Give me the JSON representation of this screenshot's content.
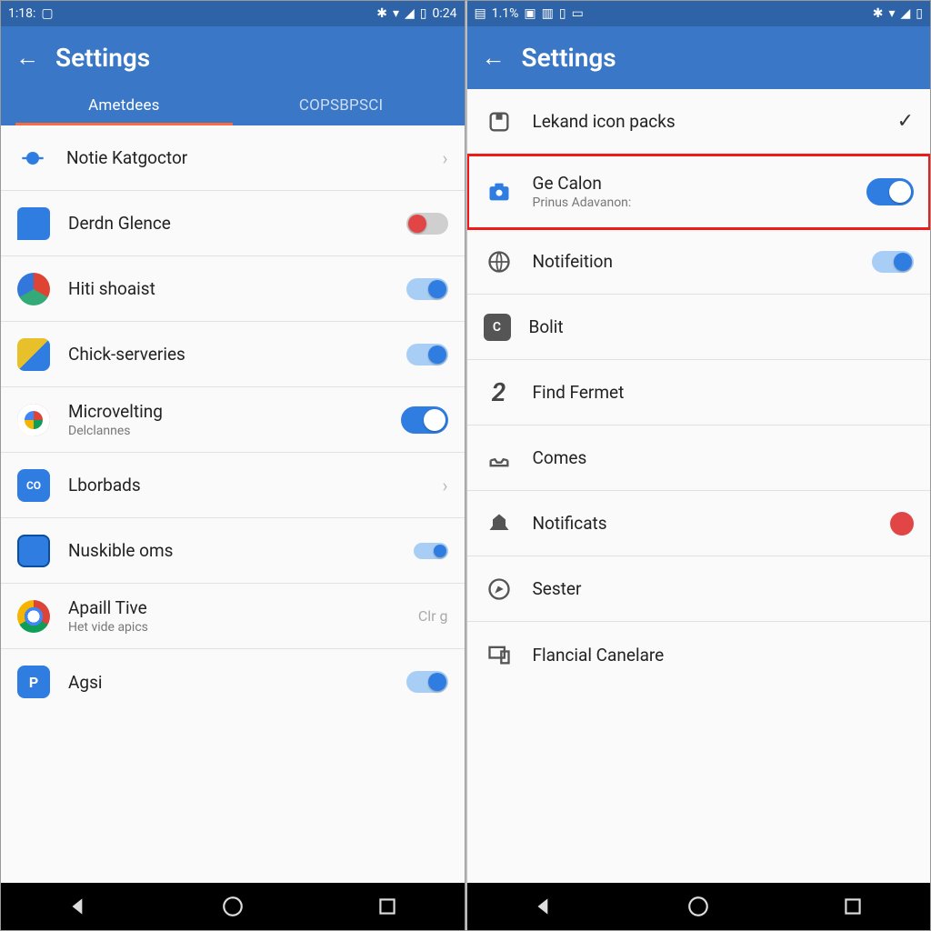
{
  "left": {
    "status": {
      "time": "1:18:",
      "clock": "0:24"
    },
    "title": "Settings",
    "tabs": [
      {
        "label": "Ametdees",
        "active": true
      },
      {
        "label": "COPSBPSCI",
        "active": false
      }
    ],
    "items": [
      {
        "label": "Notie Katgoctor",
        "sub": "",
        "end": "chev"
      },
      {
        "label": "Derdn Glence",
        "sub": "",
        "end": "pill-off"
      },
      {
        "label": "Hiti shoaist",
        "sub": "",
        "end": "pill-on"
      },
      {
        "label": "Chick-serveries",
        "sub": "",
        "end": "pill-on"
      },
      {
        "label": "Microvelting",
        "sub": "Delclannes",
        "end": "pill-onwhite"
      },
      {
        "label": "Lborbads",
        "sub": "",
        "end": "chev"
      },
      {
        "label": "Nuskible oms",
        "sub": "",
        "end": "pill-on-small"
      },
      {
        "label": "Apaill Tive",
        "sub": "Het vide apics",
        "end": "text",
        "endText": "Clr g"
      },
      {
        "label": "Agsi",
        "sub": "",
        "end": "pill-on"
      }
    ]
  },
  "right": {
    "status": {
      "left": "1.1%"
    },
    "title": "Settings",
    "items": [
      {
        "label": "Lekand icon packs",
        "sub": "",
        "end": "check"
      },
      {
        "label": "Ge Calon",
        "sub": "Prinus Adavanon:",
        "end": "pill-onwhite",
        "highlight": true
      },
      {
        "label": "Notifeition",
        "sub": "",
        "end": "pill-on"
      },
      {
        "label": "Bolit",
        "sub": "",
        "end": ""
      },
      {
        "label": "Find Fermet",
        "sub": "",
        "end": ""
      },
      {
        "label": "Comes",
        "sub": "",
        "end": ""
      },
      {
        "label": "Notificats",
        "sub": "",
        "end": "dot"
      },
      {
        "label": "Sester",
        "sub": "",
        "end": ""
      },
      {
        "label": "Flancial Canelare",
        "sub": "",
        "end": ""
      }
    ]
  }
}
